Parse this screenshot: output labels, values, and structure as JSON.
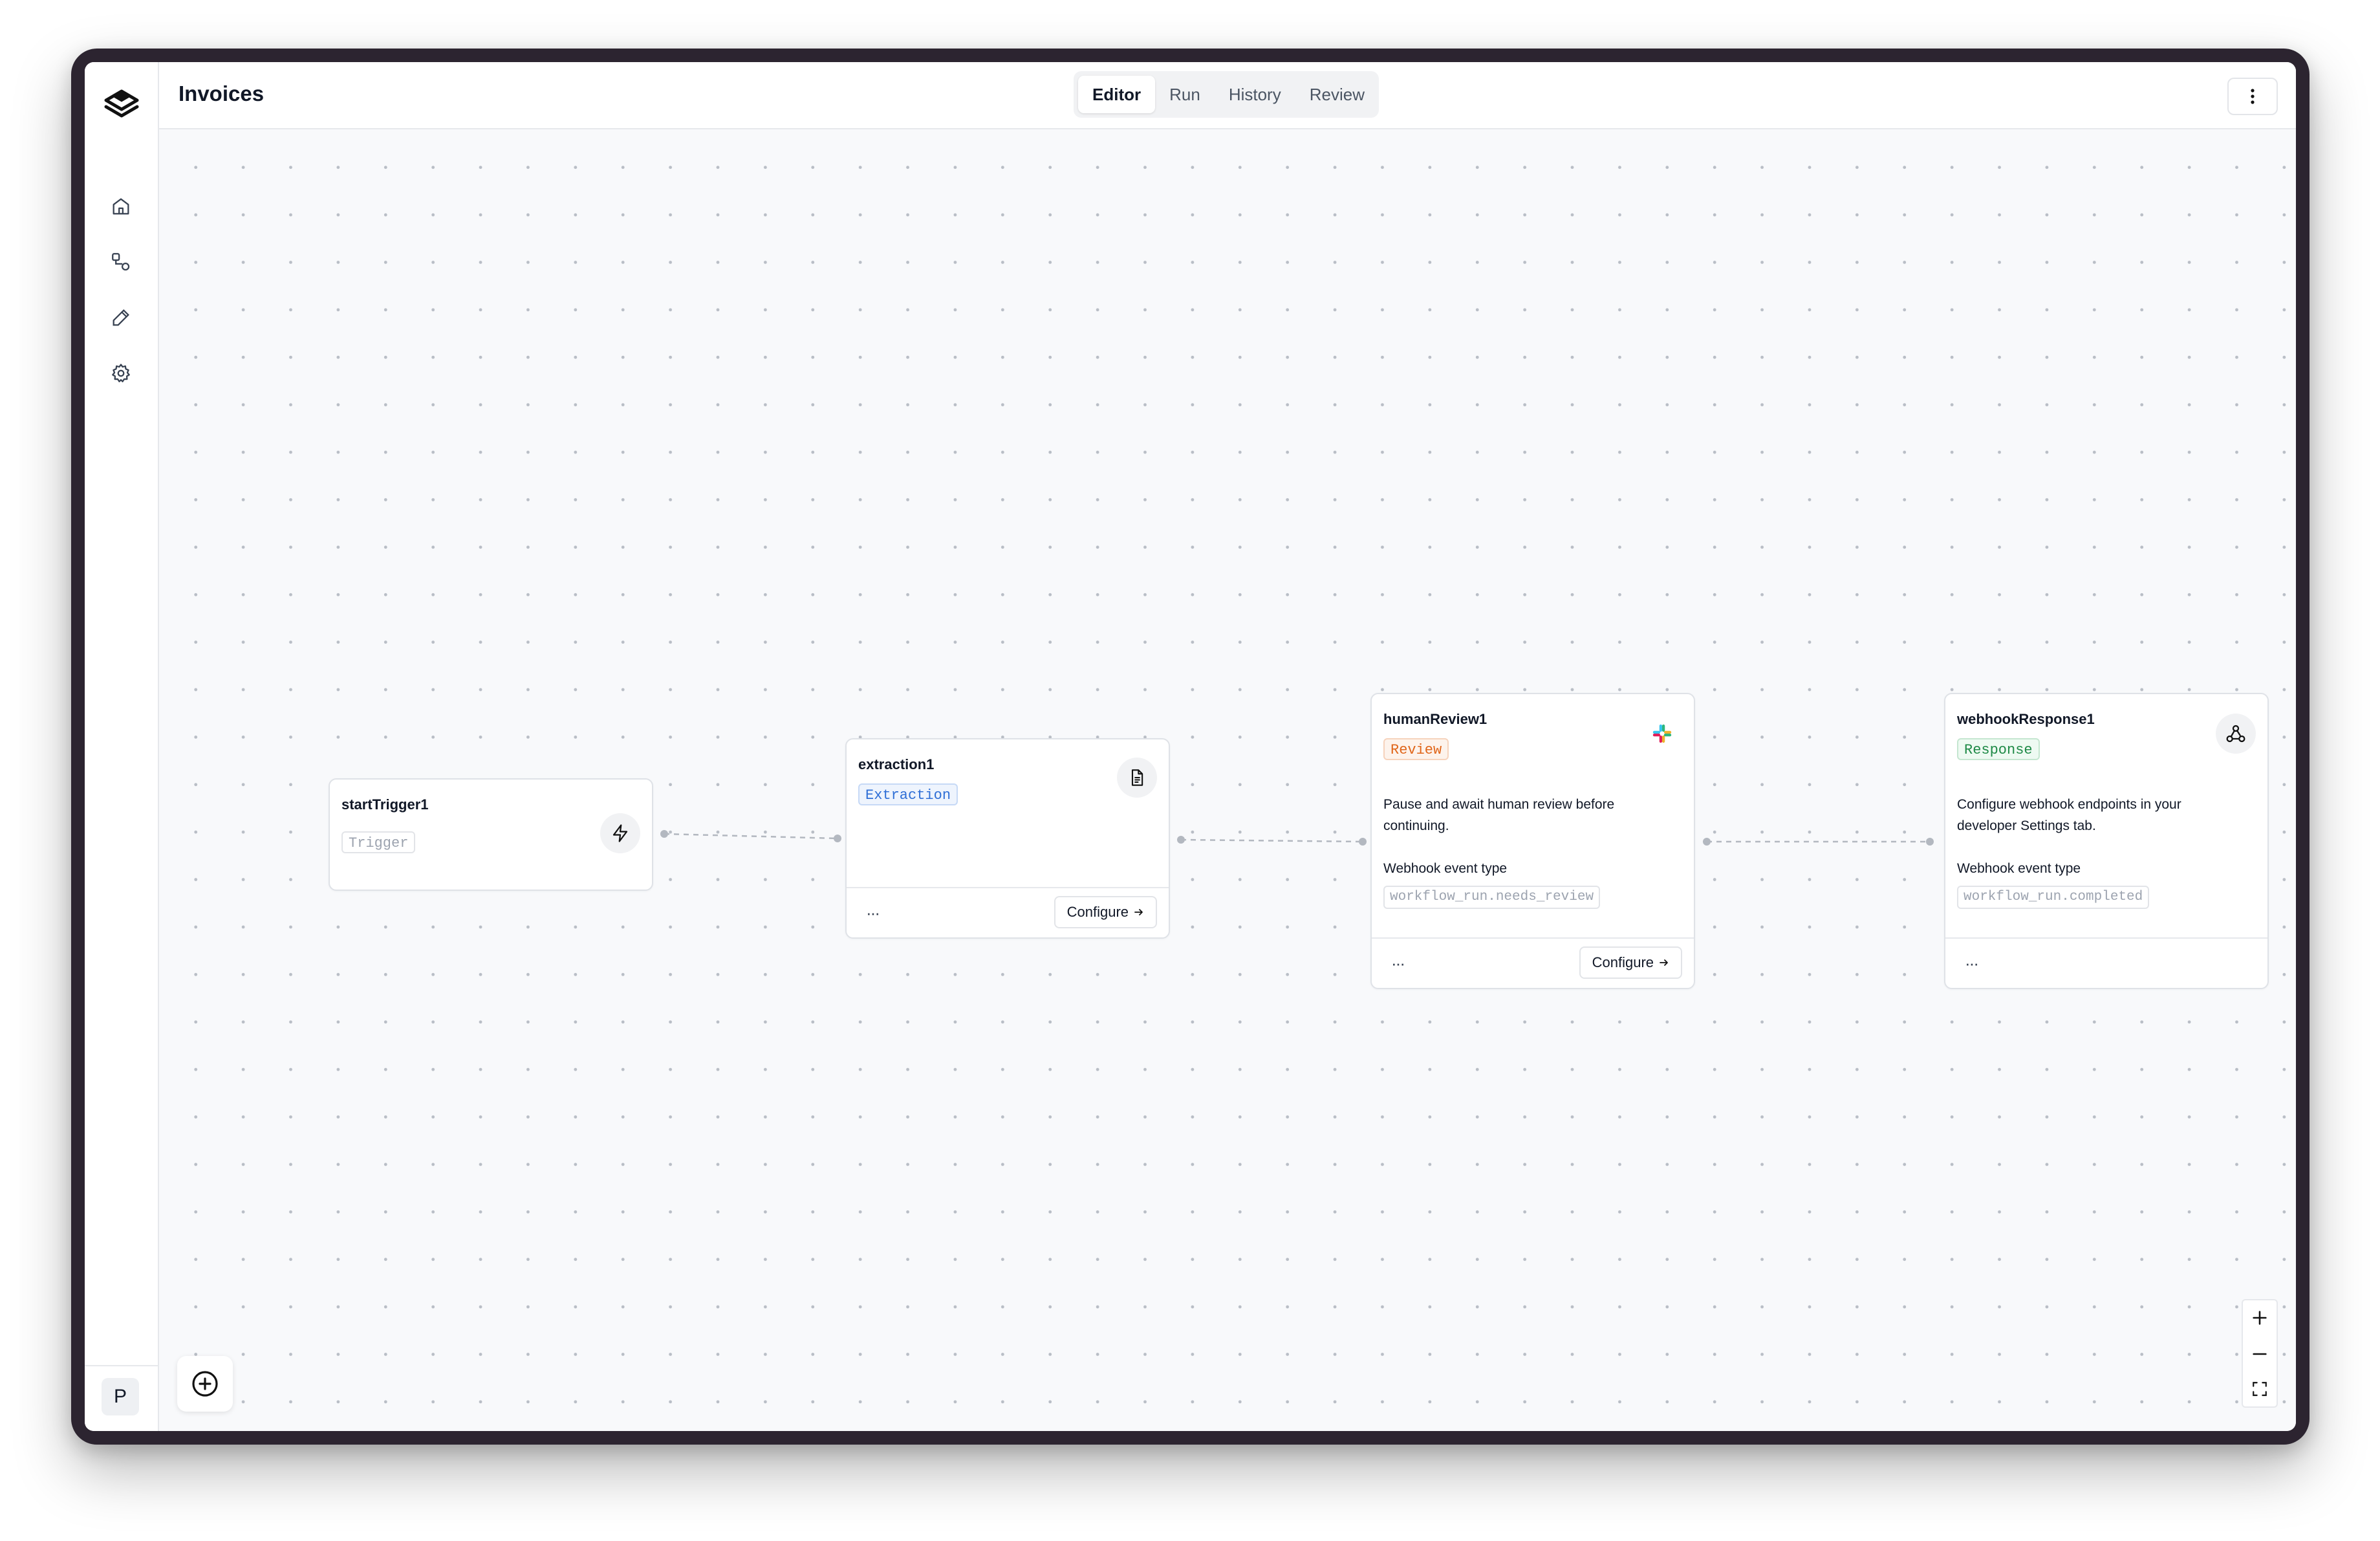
{
  "window": {
    "title": "Invoices"
  },
  "tabs": [
    {
      "label": "Editor",
      "active": true
    },
    {
      "label": "Run",
      "active": false
    },
    {
      "label": "History",
      "active": false
    },
    {
      "label": "Review",
      "active": false
    }
  ],
  "sidebar": {
    "items": [
      {
        "name": "home",
        "icon": "home-icon"
      },
      {
        "name": "workflows",
        "icon": "workflow-icon"
      },
      {
        "name": "edit",
        "icon": "pen-icon"
      },
      {
        "name": "settings",
        "icon": "gear-icon"
      }
    ],
    "avatar_initial": "P"
  },
  "nodes": {
    "start": {
      "title": "startTrigger1",
      "badge": "Trigger",
      "icon": "lightning-icon"
    },
    "extraction": {
      "title": "extraction1",
      "badge": "Extraction",
      "icon": "document-icon",
      "more": "···",
      "configure": "Configure"
    },
    "review": {
      "title": "humanReview1",
      "badge": "Review",
      "icon": "slack-icon",
      "description": "Pause and await human review before continuing.",
      "event_label": "Webhook event type",
      "event_value": "workflow_run.needs_review",
      "more": "···",
      "configure": "Configure"
    },
    "webhook": {
      "title": "webhookResponse1",
      "badge": "Response",
      "icon": "webhook-icon",
      "description": "Configure webhook endpoints in your developer Settings tab.",
      "event_label": "Webhook event type",
      "event_value": "workflow_run.completed",
      "more": "···"
    }
  },
  "colors": {
    "extraction_badge": "#2f6fd6",
    "review_badge": "#e0661a",
    "response_badge": "#1f8a47"
  }
}
